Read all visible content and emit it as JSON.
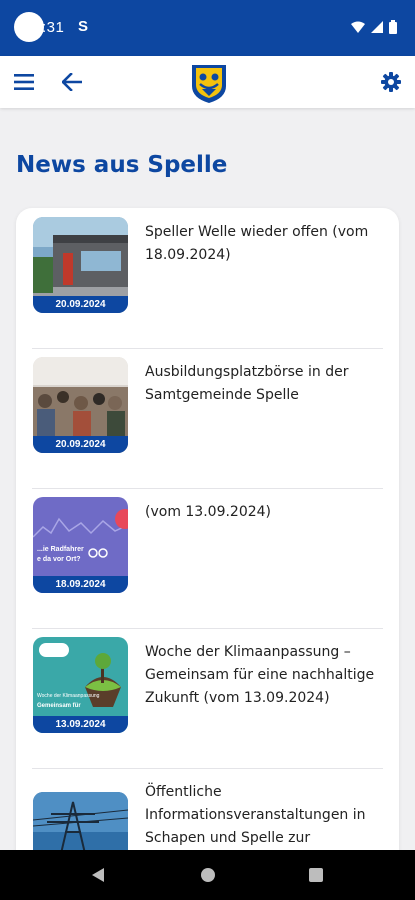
{
  "status_bar": {
    "time": ":31",
    "sync_glyph": "S",
    "icons": [
      "wifi-icon",
      "signal-icon",
      "battery-icon"
    ]
  },
  "app_bar": {
    "menu_icon": "menu-icon",
    "back_icon": "arrow-back-icon",
    "logo": "municipal-crest-logo",
    "settings_icon": "gear-icon"
  },
  "page": {
    "title": "News aus Spelle"
  },
  "news": [
    {
      "title": "Speller Welle wieder offen (vom 18.09.2024)",
      "date": "20.09.2024"
    },
    {
      "title": "Ausbildungsplatzbörse in der Samtgemeinde Spelle",
      "date": "20.09.2024"
    },
    {
      "title": "(vom 13.09.2024)",
      "date": "18.09.2024"
    },
    {
      "title": "Woche der Klimaanpassung – Gemeinsam für eine nachhaltige Zukunft (vom 13.09.2024)",
      "date": "13.09.2024"
    },
    {
      "title": "Öffentliche Informationsveranstaltungen in Schapen und Spelle zur",
      "date": ""
    }
  ],
  "thumb_text": {
    "item3_line1": "...ie Radfahrer",
    "item3_line2": "e da vor Ort?",
    "item4_line1": "Woche der Klimaanpassung",
    "item4_line2": "Gemeinsam für"
  },
  "colors": {
    "primary": "#0d47a1",
    "background": "#f0f0f2"
  }
}
